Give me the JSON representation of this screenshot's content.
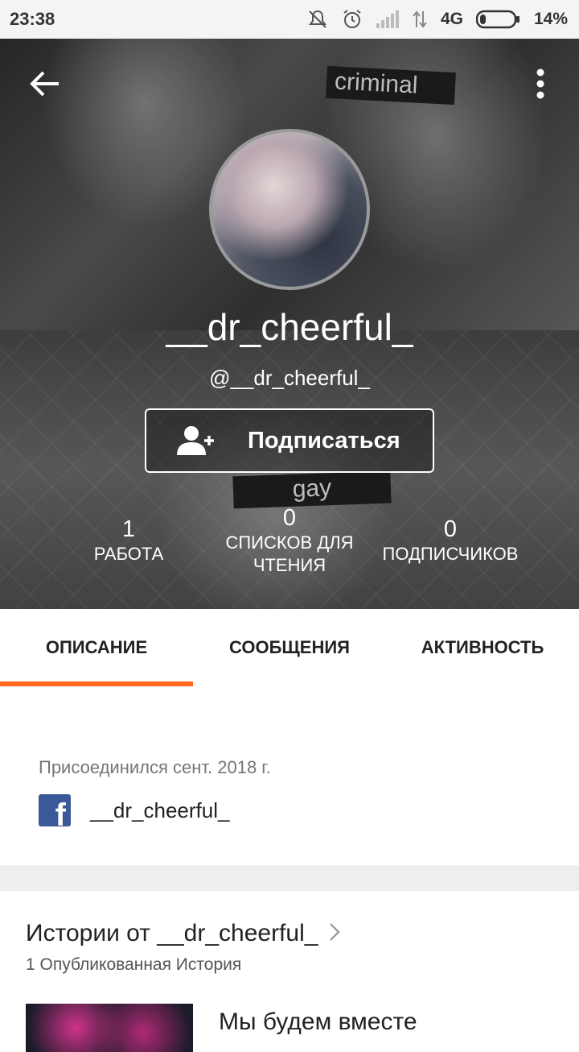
{
  "status_bar": {
    "time": "23:38",
    "network": "4G",
    "battery": "14%"
  },
  "header": {
    "stickers": [
      "criminal",
      "gay"
    ],
    "display_name": "__dr_cheerful_",
    "username": "@__dr_cheerful_",
    "follow_label": "Подписаться"
  },
  "stats": [
    {
      "value": "1",
      "label": "РАБОТА"
    },
    {
      "value": "0",
      "label": "СПИСКОВ ДЛЯ ЧТЕНИЯ"
    },
    {
      "value": "0",
      "label": "ПОДПИСЧИКОВ"
    }
  ],
  "tabs": [
    {
      "label": "ОПИСАНИЕ",
      "active": true
    },
    {
      "label": "СООБЩЕНИЯ",
      "active": false
    },
    {
      "label": "АКТИВНОСТЬ",
      "active": false
    }
  ],
  "about": {
    "joined": "Присоединился сент. 2018 г.",
    "facebook_name": "__dr_cheerful_"
  },
  "stories": {
    "title": "Истории от __dr_cheerful_",
    "count": "1 Опубликованная История",
    "first_story_title": "Мы будем вместе"
  },
  "colors": {
    "accent": "#ff6a1f",
    "facebook": "#3b5998"
  }
}
